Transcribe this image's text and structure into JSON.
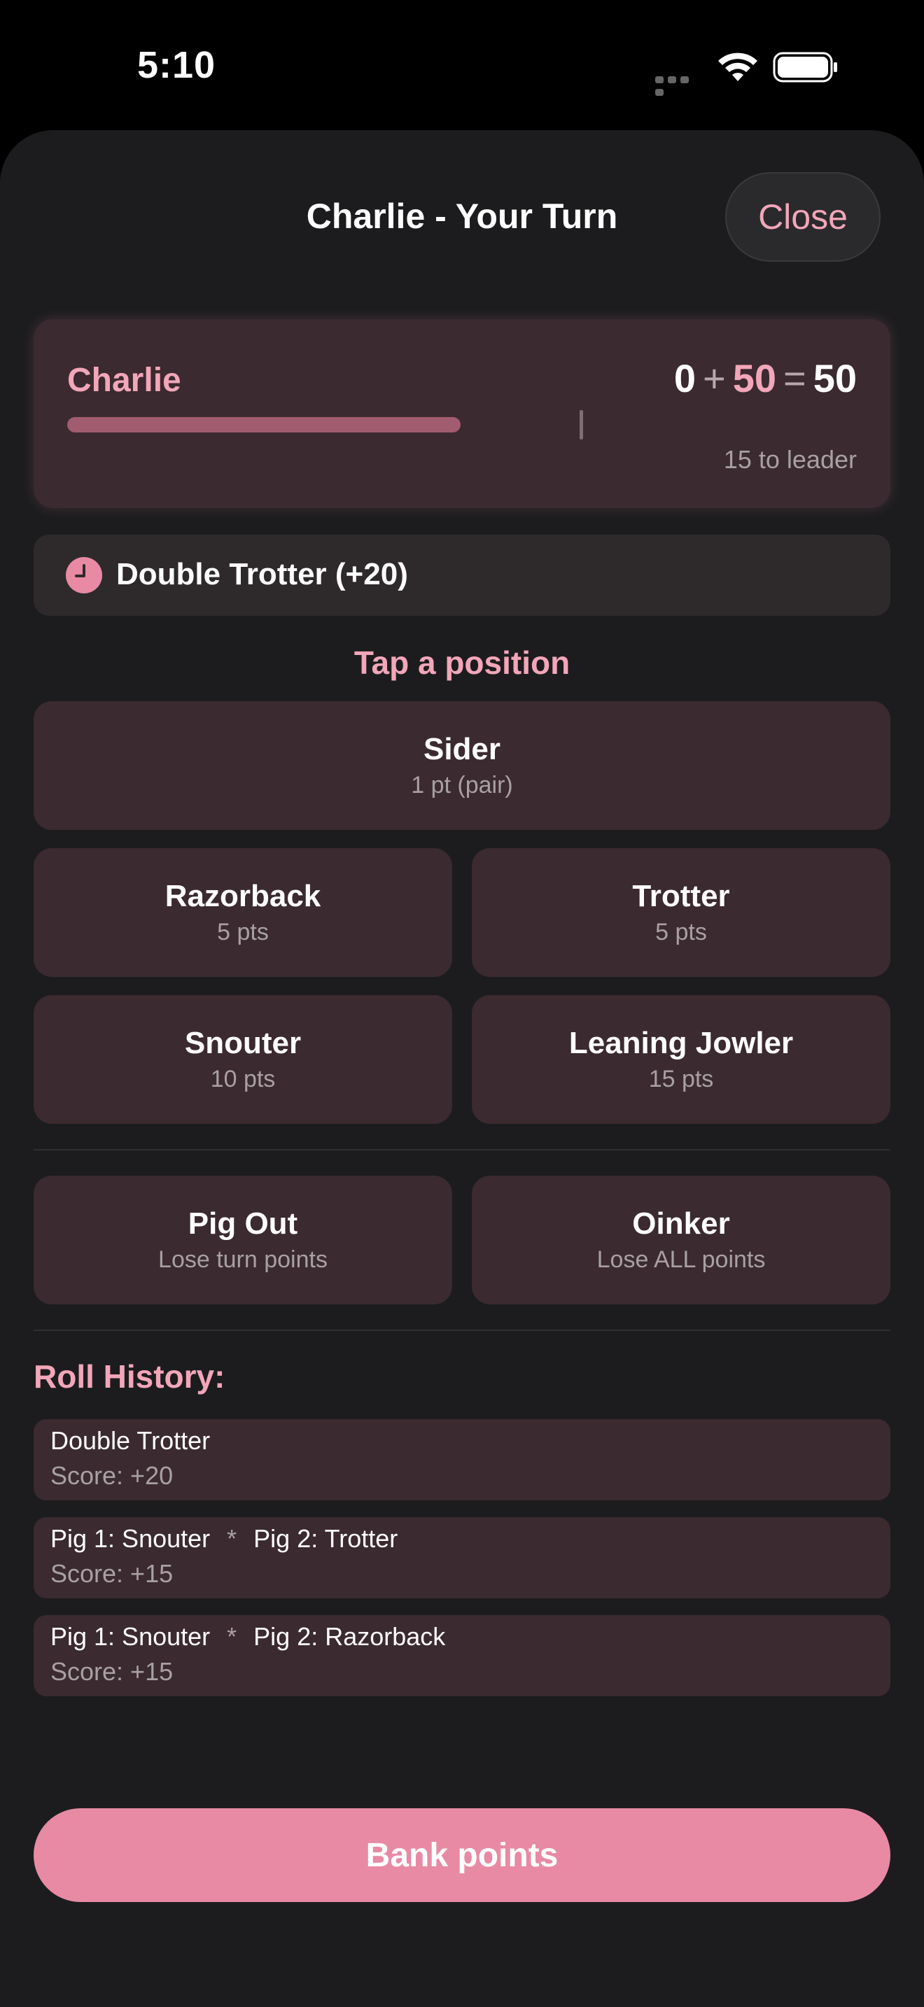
{
  "status": {
    "time": "5:10",
    "icons": [
      "cellular-dots-icon",
      "wifi-icon",
      "battery-icon"
    ]
  },
  "header": {
    "title": "Charlie - Your Turn",
    "close_label": "Close"
  },
  "player": {
    "name": "Charlie",
    "score_base": "0",
    "plus": "+",
    "score_turn": "50",
    "equals": "=",
    "score_total": "50",
    "to_leader": "15 to leader"
  },
  "bonus": {
    "icon": "clock-icon",
    "text": "Double Trotter (+20)"
  },
  "tap_label": "Tap a position",
  "positions": [
    {
      "name": "Sider",
      "points": "1 pt (pair)"
    },
    {
      "name": "Razorback",
      "points": "5 pts"
    },
    {
      "name": "Trotter",
      "points": "5 pts"
    },
    {
      "name": "Snouter",
      "points": "10 pts"
    },
    {
      "name": "Leaning Jowler",
      "points": "15 pts"
    }
  ],
  "penalties": [
    {
      "name": "Pig Out",
      "desc": "Lose turn points"
    },
    {
      "name": "Oinker",
      "desc": "Lose ALL points"
    }
  ],
  "history": {
    "title": "Roll History:",
    "items": [
      {
        "roll": "Double Trotter",
        "sep": "",
        "roll2": "",
        "score": "Score: +20"
      },
      {
        "roll": "Pig 1: Snouter",
        "sep": "*",
        "roll2": "Pig 2: Trotter",
        "score": "Score: +15"
      },
      {
        "roll": "Pig 1: Snouter",
        "sep": "*",
        "roll2": "Pig 2: Razorback",
        "score": "Score: +15"
      }
    ]
  },
  "bank_label": "Bank points",
  "colors": {
    "accent": "#e88aa4",
    "accent_text": "#f3a6b9",
    "card_bg": "#3b2a2f",
    "sheet_bg": "#1c1c1e"
  }
}
